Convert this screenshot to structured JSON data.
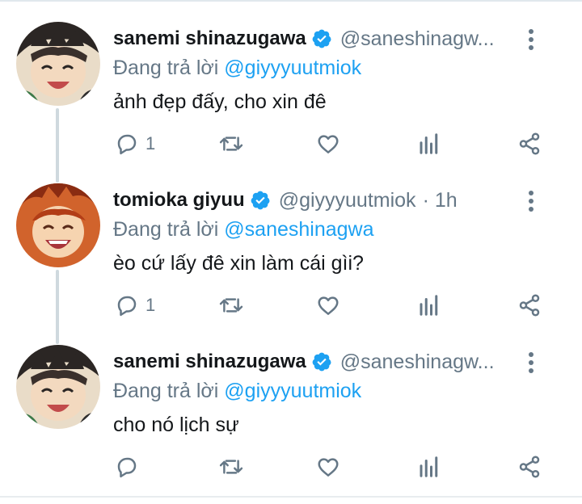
{
  "tweets": [
    {
      "display_name": "sanemi shinazugawa",
      "handle": "@saneshinagw...",
      "time": "",
      "replying_prefix": "Đang trả lời",
      "replying_to": "@giyyyuutmiok",
      "text": "ảnh đẹp đấy, cho xin đê",
      "reply_count": "1",
      "avatar": "sanemi-avatar"
    },
    {
      "display_name": "tomioka giyuu",
      "handle": "@giyyyuutmiok",
      "time": "· 1h",
      "replying_prefix": "Đang trả lời",
      "replying_to": "@saneshinagwa",
      "text": "èo cứ lấy đê xin làm cái gìi?",
      "reply_count": "1",
      "avatar": "giyuu-avatar"
    },
    {
      "display_name": "sanemi shinazugawa",
      "handle": "@saneshinagw...",
      "time": "",
      "replying_prefix": "Đang trả lời",
      "replying_to": "@giyyyuutmiok",
      "text": "cho nó lịch sự",
      "reply_count": "",
      "avatar": "sanemi-avatar"
    }
  ],
  "icons": {
    "reply": "reply-icon",
    "retweet": "retweet-icon",
    "like": "heart-icon",
    "analytics": "analytics-icon",
    "share": "share-icon",
    "more": "more-vertical-icon",
    "verified": "verified-badge-icon"
  },
  "colors": {
    "accent": "#1da1f2",
    "secondary_text": "#657786",
    "primary_text": "#14171a",
    "thread_line": "#cfd9de"
  }
}
